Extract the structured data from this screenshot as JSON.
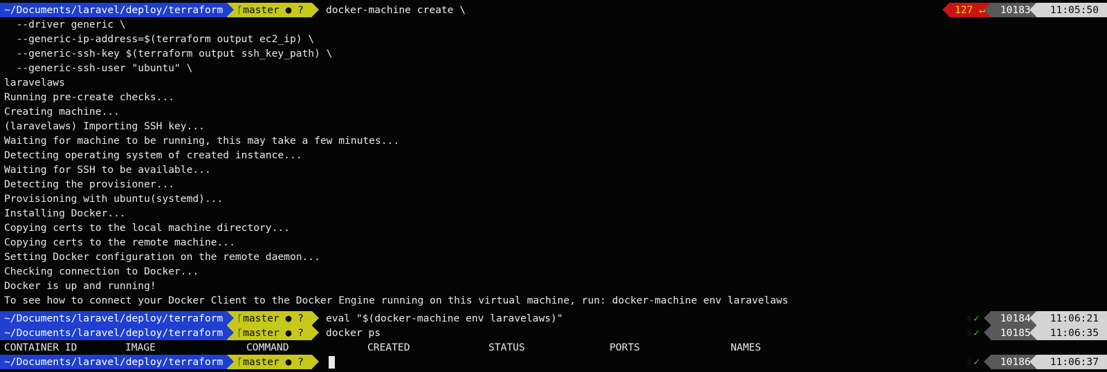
{
  "prompt": {
    "path": "~/Documents/laravel/deploy/terraform",
    "branch_icon": "git-branch-icon",
    "branch": "master",
    "git_status": "● ?"
  },
  "lines": {
    "l0_cmd": "docker-machine create \\",
    "l1": "  --driver generic \\",
    "l2": "  --generic-ip-address=$(terraform output ec2_ip) \\",
    "l3": "  --generic-ssh-key $(terraform output ssh_key_path) \\",
    "l4": "  --generic-ssh-user \"ubuntu\" \\",
    "l5": "laravelaws",
    "l6": "Running pre-create checks...",
    "l7": "Creating machine...",
    "l8": "(laravelaws) Importing SSH key...",
    "l9": "Waiting for machine to be running, this may take a few minutes...",
    "l10": "Detecting operating system of created instance...",
    "l11": "Waiting for SSH to be available...",
    "l12": "Detecting the provisioner...",
    "l13": "Provisioning with ubuntu(systemd)...",
    "l14": "Installing Docker...",
    "l15": "Copying certs to the local machine directory...",
    "l16": "Copying certs to the remote machine...",
    "l17": "Setting Docker configuration on the remote daemon...",
    "l18": "Checking connection to Docker...",
    "l19": "Docker is up and running!",
    "l20": "To see how to connect your Docker Client to the Docker Engine running on this virtual machine, run: docker-machine env laravelaws",
    "l21_cmd": "eval \"$(docker-machine env laravelaws)\"",
    "l22_cmd": "docker ps"
  },
  "table_headers": [
    "CONTAINER ID",
    "IMAGE",
    "COMMAND",
    "CREATED",
    "STATUS",
    "PORTS",
    "NAMES"
  ],
  "right_prompts": {
    "first": {
      "exit_code": "127 ↵",
      "history": "10183",
      "time": "11:05:50"
    },
    "second": {
      "status": "✓",
      "history": "10184",
      "time": "11:06:21"
    },
    "third": {
      "status": "✓",
      "history": "10185",
      "time": "11:06:35"
    },
    "fourth": {
      "status": "✓",
      "history": "10186",
      "time": "11:06:37"
    }
  },
  "colors": {
    "path_bg": "#1e3fd0",
    "git_bg": "#c6c91a",
    "error_bg": "#c81414",
    "history_bg": "#595959",
    "time_bg": "#d4d4d4",
    "ok_fg": "#2ec82e"
  }
}
